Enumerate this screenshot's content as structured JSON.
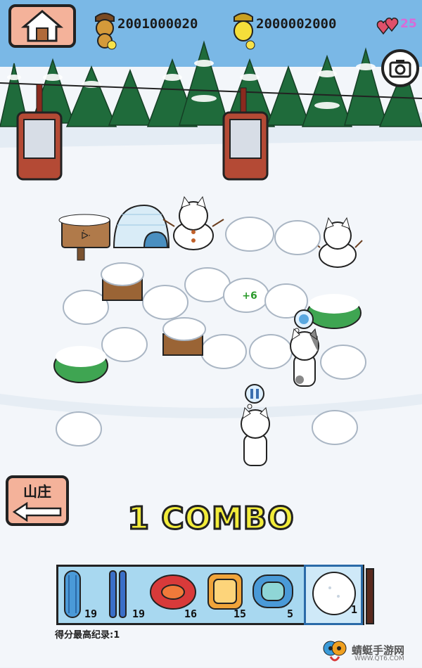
{
  "hud": {
    "acorn_count": "2001000020",
    "gold_acorn_count": "2000002000",
    "hearts": "25"
  },
  "field": {
    "bonus_popup": "+6"
  },
  "nav": {
    "back_label": "山庄"
  },
  "combo": {
    "text": "1 COMBO"
  },
  "inventory": {
    "slots": [
      {
        "icon": "blue-sled-icon",
        "count": "19"
      },
      {
        "icon": "blue-skis-icon",
        "count": "19"
      },
      {
        "icon": "red-float-icon",
        "count": "16"
      },
      {
        "icon": "orange-basket-icon",
        "count": "15"
      },
      {
        "icon": "blue-float-icon",
        "count": "5"
      },
      {
        "icon": "snowball-icon",
        "count": "1"
      }
    ]
  },
  "footer": {
    "high_score_label": "得分最高纪录:1"
  },
  "watermark": {
    "name": "蜻蜓手游网",
    "url": "WWW.QT6.COM"
  },
  "colors": {
    "sky": "#7ab8e6",
    "snow": "#f3f6fa",
    "tree": "#1f6b3b",
    "button_pink": "#f4b29a",
    "combo_yellow": "#f2ec3a",
    "inventory_bg": "#a8d8f0"
  }
}
